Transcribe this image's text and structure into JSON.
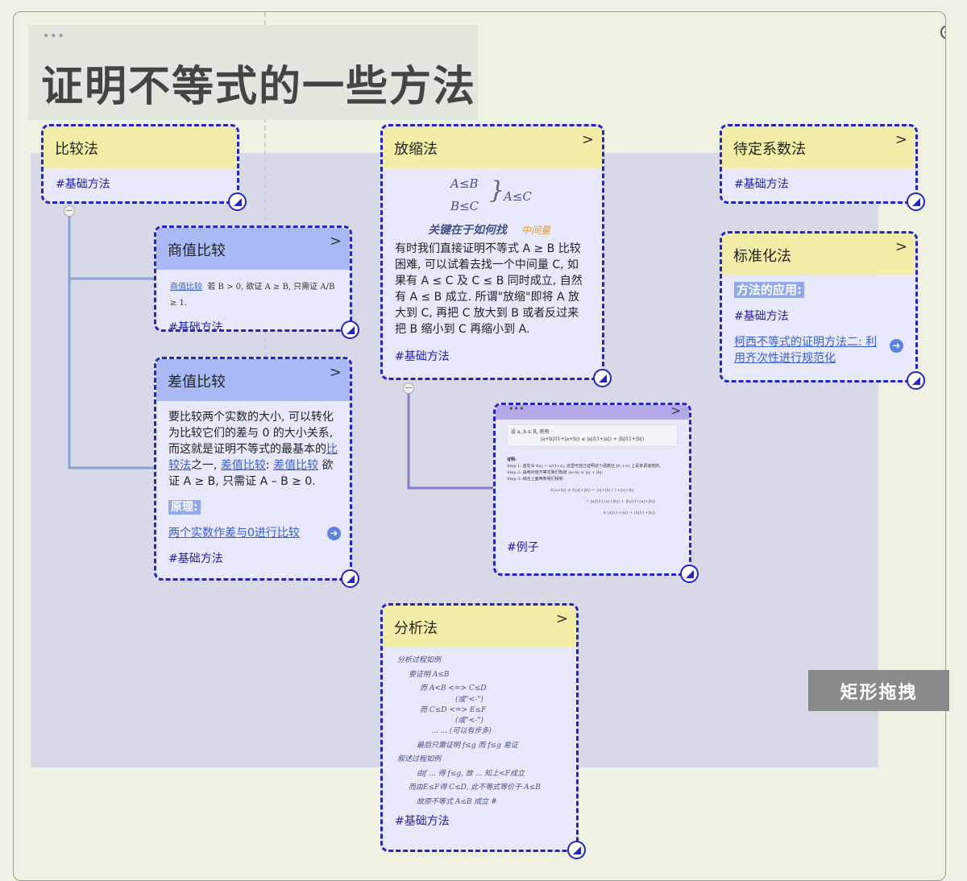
{
  "title": {
    "dots": "•••",
    "text": "证明不等式的一些方法"
  },
  "drag_tip": "矩形拖拽",
  "cards": {
    "bijiaofa": {
      "title": "比较法",
      "tag": "#基础方法"
    },
    "shangzhi": {
      "title": "商值比较",
      "chevron": ">",
      "formula_link": "商值比较",
      "formula": "若 B > 0, 欲证 A ≥ B, 只需证 A/B ≥ 1.",
      "tag": "#基础方法"
    },
    "chazhi": {
      "title": "差值比较",
      "chevron": ">",
      "body_1": "要比较两个实数的大小, 可以转化为比较它们的差与 0 的大小关系, 而这就是证明不等式的最基本的",
      "link_1": "比较法",
      "body_2": "之一, ",
      "link_2": "差值比较",
      "body_3": ": ",
      "link_3": "差值比较",
      "body_4": " 欲证 A ≥ B, 只需证 A – B ≥ 0.",
      "principle": "原理:",
      "principle_link": "两个实数作差与0进行比较",
      "tag": "#基础方法"
    },
    "fangsuo": {
      "title": "放缩法",
      "chevron": ">",
      "hw_1": "A≤B",
      "hw_2": "B≤C",
      "hw_3": "A≤C",
      "hw_key": "关键在于如何找",
      "hw_mid": "中间量",
      "body": "有时我们直接证明不等式 A ≥ B 比较困难, 可以试着去找一个中间量 C, 如果有 A ≤ C 及 C ≤ B 同时成立, 自然有 A ≤ B 成立. 所谓\"放缩\"即将 A 放大到 C, 再把 C 放大到 B 或者反过来把 B 缩小到 C 再缩小到 A.",
      "tag": "#基础方法"
    },
    "example": {
      "dots": "•••",
      "chevron": ">",
      "line_1": "设 a, b ∈ R, 则有",
      "line_2": "|a+b|/(1+|a+b|) ≤ |a|/(1+|a|) + |b|/(1+|b|)",
      "proof": "证明:",
      "step1": "Step 1: 首先令 f(x) = x/(1+x), 这里可自己证明这个函数在 [0,+∞) 上是单调递增的;",
      "step2": "Step 2: 由绝对值不等式我们知道 |a+b| ≤ |a| + |b|;",
      "step3": "Step 3: 综合上面两条我们得到",
      "tag": "#例子"
    },
    "daiding": {
      "title": "待定系数法",
      "chevron": ">",
      "tag": "#基础方法"
    },
    "biaozhun": {
      "title": "标准化法",
      "chevron": ">",
      "app": "方法的应用:",
      "tag": "#基础方法",
      "link": "柯西不等式的证明方法二: 利用齐次性进行规范化"
    },
    "fenxi": {
      "title": "分析法",
      "chevron": ">",
      "hw_lines": [
        "分析过程如例",
        "要证明 A≤B",
        "而 A<B <=> C≤D",
        "(或\"<-\")",
        "而 C≤D <=> E≤F",
        "(或\"<-\")",
        "... ... (可以有步多)",
        "最后只需证明 f≤g 而 f≤g 易证",
        "叙述过程如例",
        "由f ... 得 f≤g, 故 ... 知上<F成立",
        "而由E≤F得 C≤D, 此不等式等价于 A≤B",
        "故原不等式 A≤B 成立 #"
      ],
      "tag": "#基础方法"
    }
  },
  "colors": {
    "card_border": "#2424cc",
    "head_yellow": "#f2eda6",
    "head_blue": "#a9b9f4",
    "tag": "#2020b0",
    "link": "#3a5fd0",
    "selection": "#c8cce8"
  }
}
